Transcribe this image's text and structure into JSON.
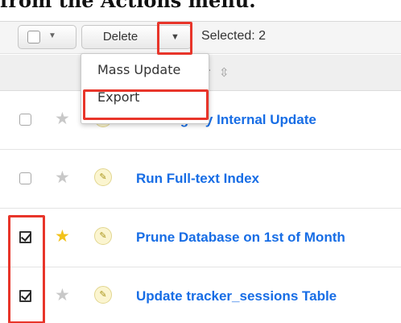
{
  "caption": "from the Actions menu.",
  "toolbar": {
    "caret_glyph": "▼",
    "delete_label": "Delete",
    "dropdown_glyph": "▼",
    "selected_text": "Selected: 2"
  },
  "header": {
    "column_label": "er",
    "sort_glyph": "⇳"
  },
  "actions_menu": {
    "items": [
      {
        "label": "Mass Update"
      },
      {
        "label": "Export"
      }
    ]
  },
  "rows": [
    {
      "name": "Run Nightly Internal Update",
      "checked": false,
      "favorite": false
    },
    {
      "name": "Run Full-text Index",
      "checked": false,
      "favorite": false
    },
    {
      "name": "Prune Database on 1st of Month",
      "checked": true,
      "favorite": true
    },
    {
      "name": "Update tracker_sessions Table",
      "checked": true,
      "favorite": false
    }
  ],
  "icons": {
    "star": "★",
    "pencil": "✎"
  },
  "colors": {
    "highlight": "#e8352a",
    "link": "#176de5",
    "favorite_star": "#f2c21b"
  }
}
